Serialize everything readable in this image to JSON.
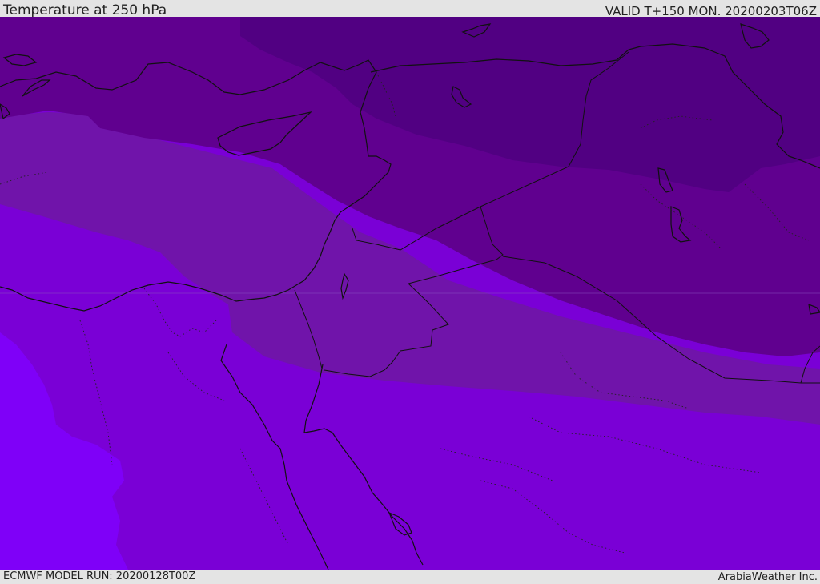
{
  "header": {
    "title": "Temperature at 250 hPa",
    "valid": "VALID T+150 MON. 20200203T06Z"
  },
  "footer": {
    "model_run": "ECMWF MODEL RUN: 20200128T00Z",
    "credit": "ArabiaWeather Inc."
  },
  "map": {
    "bands": [
      {
        "name": "darkest",
        "color": "#510082"
      },
      {
        "name": "dark",
        "color": "#60008f"
      },
      {
        "name": "mid",
        "color": "#7014aa"
      },
      {
        "name": "medium",
        "color": "#7a00d6"
      },
      {
        "name": "light",
        "color": "#7f00f8"
      }
    ],
    "line_color": "#111111"
  }
}
